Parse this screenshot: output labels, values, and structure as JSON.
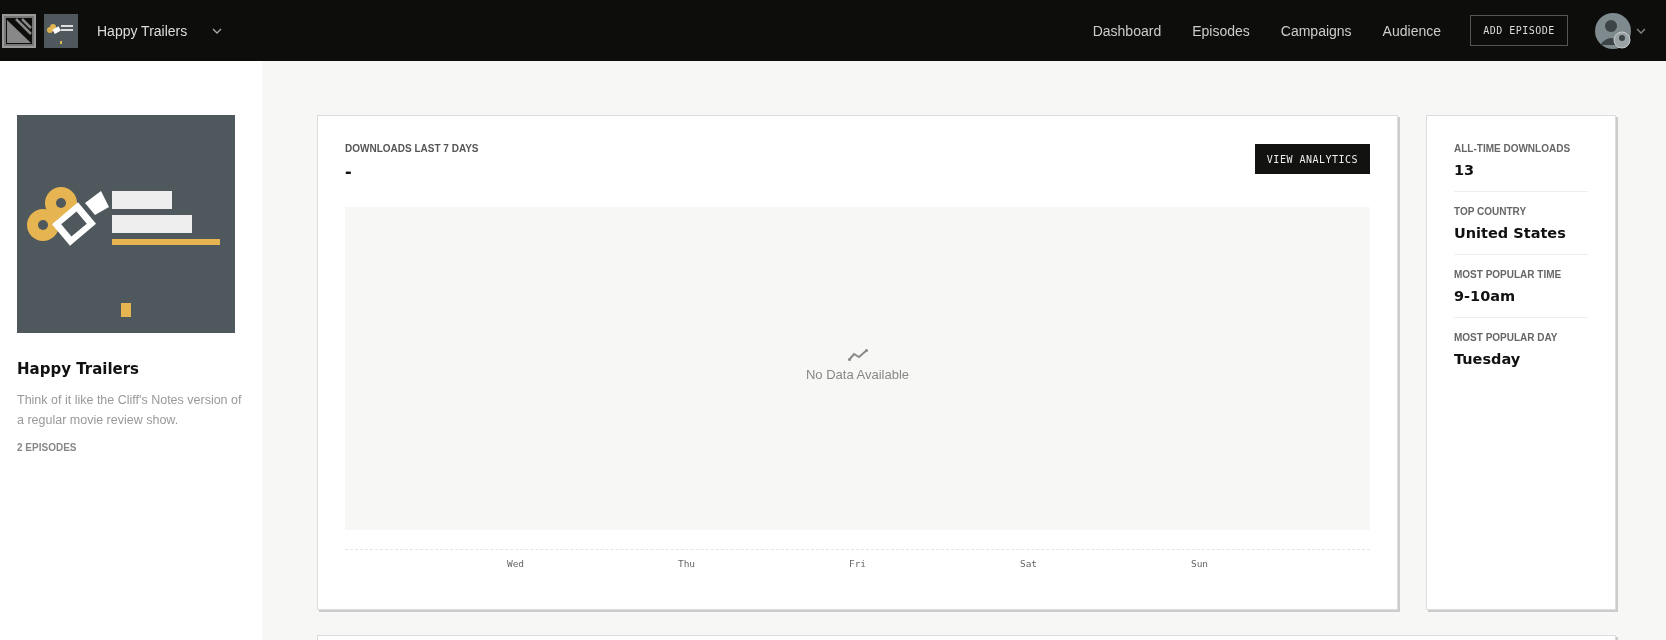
{
  "header": {
    "show_name": "Happy Trailers",
    "nav": [
      {
        "label": "Dashboard",
        "selected": false
      },
      {
        "label": "Episodes",
        "selected": false
      },
      {
        "label": "Campaigns",
        "selected": false
      },
      {
        "label": "Audience",
        "selected": false
      }
    ],
    "add_button": "ADD EPISODE"
  },
  "sidebar": {
    "title": "Happy Trailers",
    "description": "Think of it like the Cliff's Notes version of a regular movie review show.",
    "episodes": "2 EPISODES"
  },
  "downloads": {
    "title": "DOWNLOADS LAST 7 DAYS",
    "value": "-",
    "button": "VIEW ANALYTICS",
    "empty_message": "No Data Available",
    "days": [
      "Wed",
      "Thu",
      "Fri",
      "Sat",
      "Sun"
    ]
  },
  "stats": [
    {
      "label": "ALL-TIME DOWNLOADS",
      "value": "13"
    },
    {
      "label": "TOP COUNTRY",
      "value": "United States"
    },
    {
      "label": "MOST POPULAR TIME",
      "value": "9-10am"
    },
    {
      "label": "MOST POPULAR DAY",
      "value": "Tuesday"
    }
  ]
}
